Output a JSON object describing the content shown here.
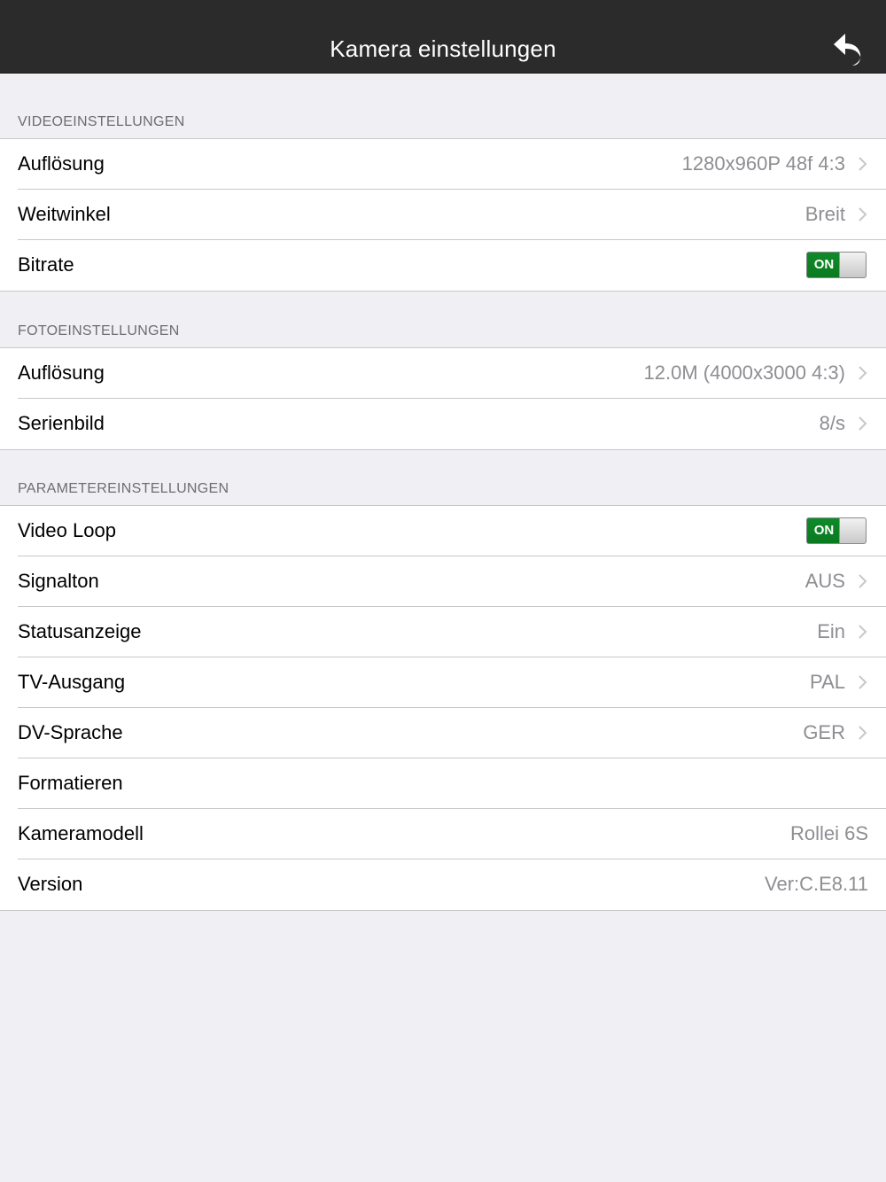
{
  "header": {
    "title": "Kamera einstellungen",
    "back_icon": "back-arrow-icon"
  },
  "colors": {
    "navbar": "#2b2b2b",
    "background": "#efeff4",
    "toggle_on": "#0a7a20",
    "value_gray": "#8e8e93"
  },
  "video": {
    "header": "VIDEOEINSTELLUNGEN",
    "rows": [
      {
        "label": "Auflösung",
        "value": "1280x960P 48f 4:3"
      },
      {
        "label": "Weitwinkel",
        "value": "Breit"
      },
      {
        "label": "Bitrate",
        "toggle": "ON"
      }
    ]
  },
  "photo": {
    "header": "FOTOEINSTELLUNGEN",
    "rows": [
      {
        "label": "Auflösung",
        "value": "12.0M (4000x3000 4:3)"
      },
      {
        "label": "Serienbild",
        "value": "8/s"
      }
    ]
  },
  "params": {
    "header": "PARAMETEREINSTELLUNGEN",
    "rows": [
      {
        "label": "Video Loop",
        "toggle": "ON"
      },
      {
        "label": "Signalton",
        "value": "AUS"
      },
      {
        "label": "Statusanzeige",
        "value": "Ein"
      },
      {
        "label": "TV-Ausgang",
        "value": "PAL"
      },
      {
        "label": "DV-Sprache",
        "value": "GER"
      },
      {
        "label": "Formatieren"
      },
      {
        "label": "Kameramodell",
        "value": "Rollei 6S"
      },
      {
        "label": "Version",
        "value": "Ver:C.E8.11"
      }
    ]
  }
}
